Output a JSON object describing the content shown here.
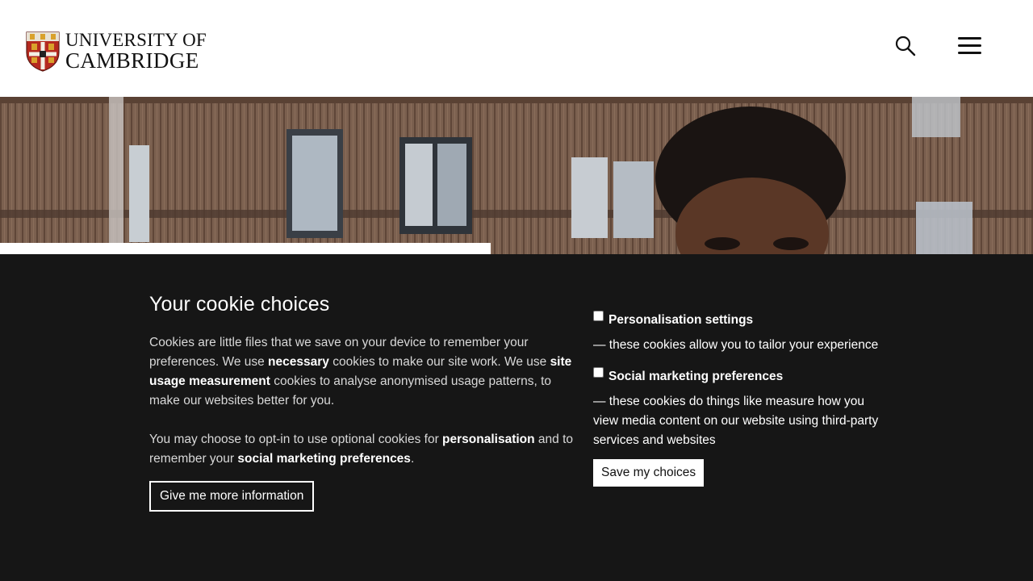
{
  "header": {
    "logo": {
      "line1": "UNIVERSITY OF",
      "line2": "CAMBRIDGE",
      "icon": "university-crest"
    },
    "search_icon": "search-icon",
    "menu_icon": "menu-icon"
  },
  "cookie_banner": {
    "title": "Your cookie choices",
    "paragraph1": {
      "t1": "Cookies are little files that we save on your device to remember your preferences. We use ",
      "b1": "necessary",
      "t2": " cookies to make our site work. We use ",
      "b2": "site usage measurement",
      "t3": " cookies to analyse anonymised usage patterns, to make our websites better for you."
    },
    "paragraph2": {
      "t1": "You may choose to opt-in to use optional cookies for ",
      "b1": "personalisation",
      "t2": " and to remember your ",
      "b2": "social marketing preferences",
      "t3": "."
    },
    "more_info_button": "Give me more information",
    "options": [
      {
        "label": "Personalisation settings",
        "description": "— these cookies allow you to tailor your experience",
        "checked": false
      },
      {
        "label": "Social marketing preferences",
        "description": "— these cookies do things like measure how you view media content on our website using third-party services and websites",
        "checked": false
      }
    ],
    "save_button": "Save my choices"
  },
  "colors": {
    "banner_background": "#161616",
    "crest_red": "#b5291f",
    "crest_gold": "#d9a12b"
  }
}
